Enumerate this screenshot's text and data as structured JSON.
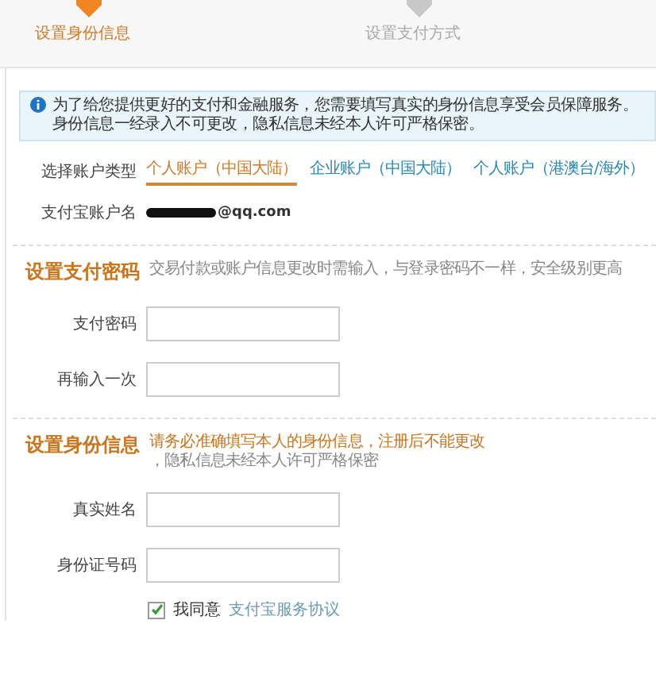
{
  "steps": [
    {
      "label": "设置身份信息",
      "selected": true
    },
    {
      "label": "设置支付方式",
      "selected": false
    }
  ],
  "notice": {
    "lines": [
      "为了给您提供更好的支付和金融服务，您需要填写真实的身份信息享受会员保障服务。",
      "身份信息一经录入不可更改，隐私信息未经本人许可严格保密。"
    ]
  },
  "account": {
    "type_label": "选择账户类型",
    "types": [
      {
        "label": "个人账户（中国大陆）",
        "selected": true
      },
      {
        "label": "企业账户（中国大陆）",
        "selected": false
      },
      {
        "label": "个人账户（港澳台/海外）",
        "selected": false
      }
    ],
    "name_label": "支付宝账户名",
    "name_value": "@qq.com"
  },
  "sections": [
    {
      "title": "设置支付密码",
      "hint": "交易付款或账户信息更改时需输入，与登录密码不一样，安全级别更高",
      "fields": [
        {
          "label": "支付密码"
        },
        {
          "label": "再输入一次"
        }
      ]
    },
    {
      "title": "设置身份信息",
      "hint_strong": "请务必准确填写本人的身份信息，注册后不能更改",
      "hint": "，隐私信息未经本人许可严格保密",
      "fields": [
        {
          "label": "真实姓名"
        },
        {
          "label": "身份证号码"
        }
      ]
    }
  ],
  "agreement": {
    "checked": true,
    "text": "我同意",
    "link": "支付宝服务协议"
  }
}
